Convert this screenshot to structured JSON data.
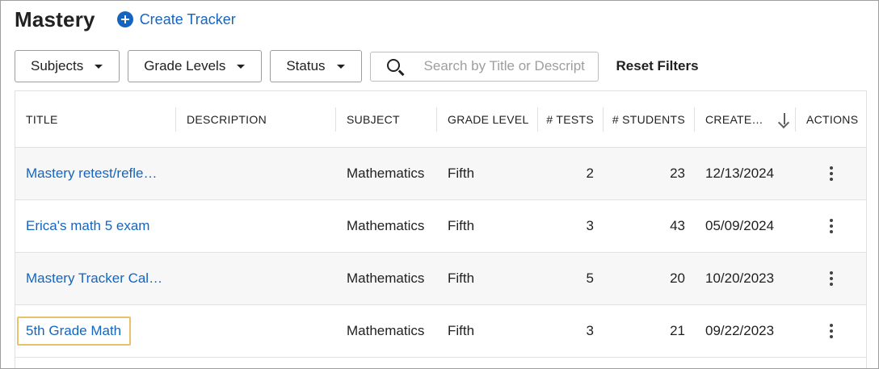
{
  "header": {
    "title": "Mastery",
    "create_label": "Create Tracker"
  },
  "filters": {
    "subjects_label": "Subjects",
    "grade_levels_label": "Grade Levels",
    "status_label": "Status",
    "search_placeholder": "Search by Title or Description",
    "reset_label": "Reset Filters"
  },
  "table": {
    "columns": {
      "title": "TITLE",
      "description": "DESCRIPTION",
      "subject": "SUBJECT",
      "grade_level": "GRADE LEVEL",
      "tests": "# TESTS",
      "students": "# STUDENTS",
      "created": "CREATE…",
      "actions": "ACTIONS"
    },
    "rows": [
      {
        "title": "Mastery retest/reflection",
        "description": "",
        "subject": "Mathematics",
        "grade": "Fifth",
        "tests": "2",
        "students": "23",
        "created": "12/13/2024"
      },
      {
        "title": "Erica's math 5 exam",
        "description": "",
        "subject": "Mathematics",
        "grade": "Fifth",
        "tests": "3",
        "students": "43",
        "created": "05/09/2024"
      },
      {
        "title": "Mastery Tracker Calendar",
        "description": "",
        "subject": "Mathematics",
        "grade": "Fifth",
        "tests": "5",
        "students": "20",
        "created": "10/20/2023"
      },
      {
        "title": "5th Grade Math",
        "description": "",
        "subject": "Mathematics",
        "grade": "Fifth",
        "tests": "3",
        "students": "21",
        "created": "09/22/2023"
      }
    ]
  },
  "colors": {
    "link": "#1565c0",
    "highlight": "#e8c26a",
    "row_shade": "#f7f7f7"
  },
  "icons": [
    "plus-circle-icon",
    "caret-down-icon",
    "search-icon",
    "arrow-down-icon",
    "more-vertical-icon"
  ]
}
